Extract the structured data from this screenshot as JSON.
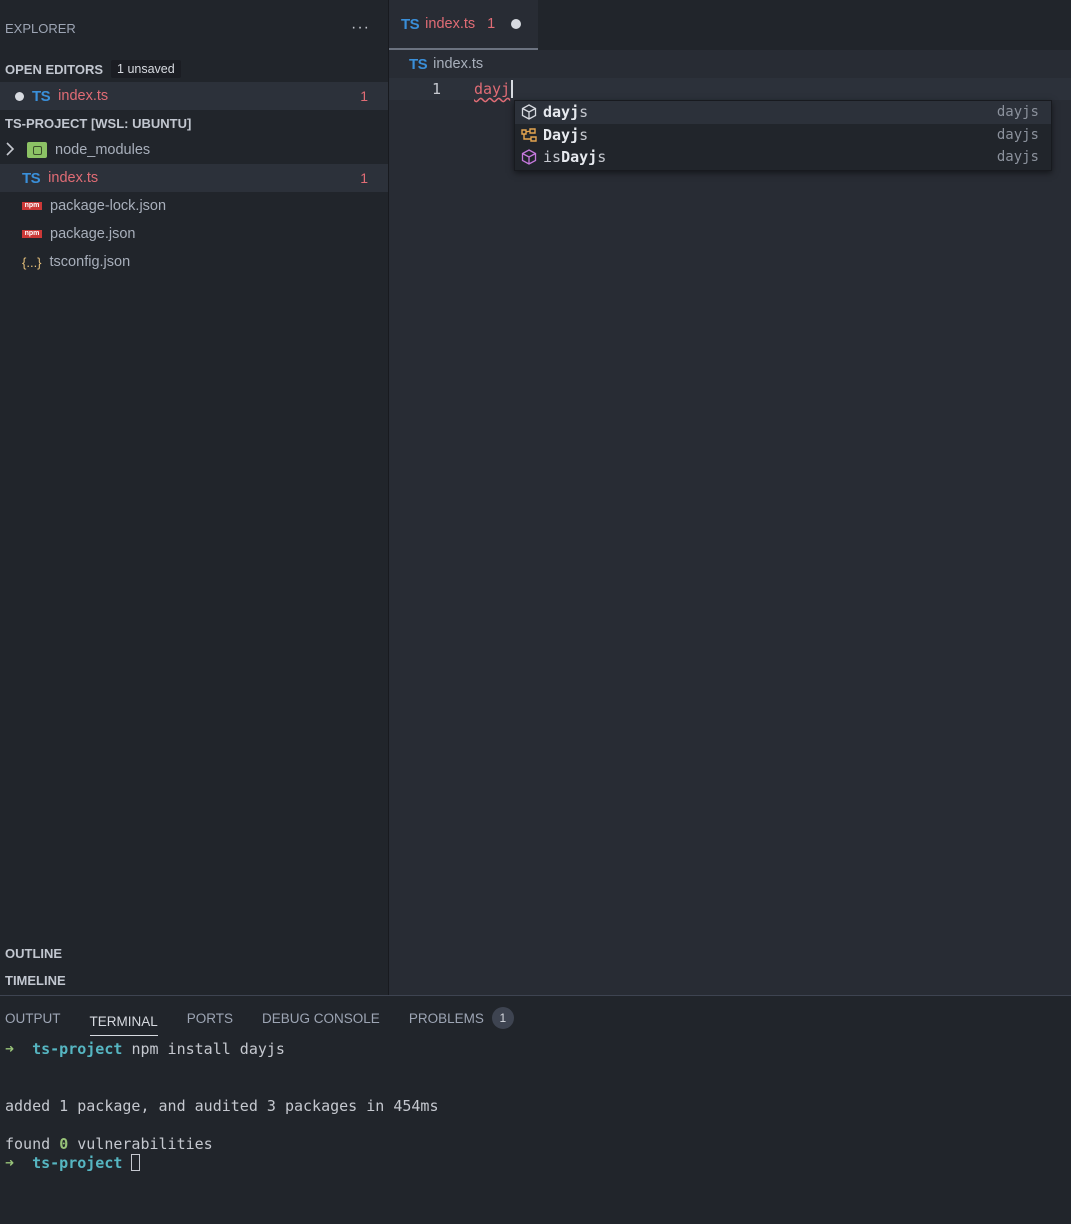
{
  "sidebar": {
    "title": "EXPLORER",
    "more_label": "···",
    "open_editors": {
      "label": "OPEN EDITORS",
      "badge": "1 unsaved",
      "items": [
        {
          "icon": "TS",
          "name": "index.ts",
          "count": "1"
        }
      ]
    },
    "project": {
      "label": "TS-PROJECT [WSL: UBUNTU]",
      "items": [
        {
          "icon": "node-modules-folder-icon",
          "name": "node_modules"
        },
        {
          "icon": "TS",
          "name": "index.ts",
          "count": "1"
        },
        {
          "icon": "npm",
          "name": "package-lock.json"
        },
        {
          "icon": "npm",
          "name": "package.json"
        },
        {
          "icon": "{...}",
          "name": "tsconfig.json"
        }
      ]
    },
    "outline_label": "OUTLINE",
    "timeline_label": "TIMELINE"
  },
  "editor": {
    "tab": {
      "icon": "TS",
      "name": "index.ts",
      "count": "1"
    },
    "breadcrumb": {
      "icon": "TS",
      "name": "index.ts"
    },
    "lines": [
      {
        "num": "1",
        "text": "dayj"
      }
    ],
    "suggestions": [
      {
        "icon": "module-icon",
        "match": "dayj",
        "rest": "s",
        "prefix": "",
        "detail": "dayjs",
        "color": "#e6e9ee"
      },
      {
        "icon": "class-icon",
        "match": "Dayj",
        "rest": "s",
        "prefix": "",
        "detail": "dayjs",
        "color": "#e5a550"
      },
      {
        "icon": "module-icon",
        "match": "Dayj",
        "rest": "s",
        "prefix": "is",
        "detail": "dayjs",
        "color": "#c678dd"
      }
    ]
  },
  "panel": {
    "tabs": [
      "OUTPUT",
      "TERMINAL",
      "PORTS",
      "DEBUG CONSOLE",
      "PROBLEMS"
    ],
    "problems_count": "1",
    "terminal": {
      "arrow": "➜",
      "dir": "ts-project",
      "command": "npm install dayjs",
      "output1": "added 1 package, and audited 3 packages in 454ms",
      "found_prefix": "found ",
      "found_count": "0",
      "found_suffix": " vulnerabilities"
    }
  },
  "colors": {
    "background": "#282c34",
    "sidebar": "#21252b",
    "error": "#e06c75",
    "ts_blue": "#3a8fd9",
    "terminal_green": "#98c379",
    "terminal_cyan": "#56b6c2"
  }
}
